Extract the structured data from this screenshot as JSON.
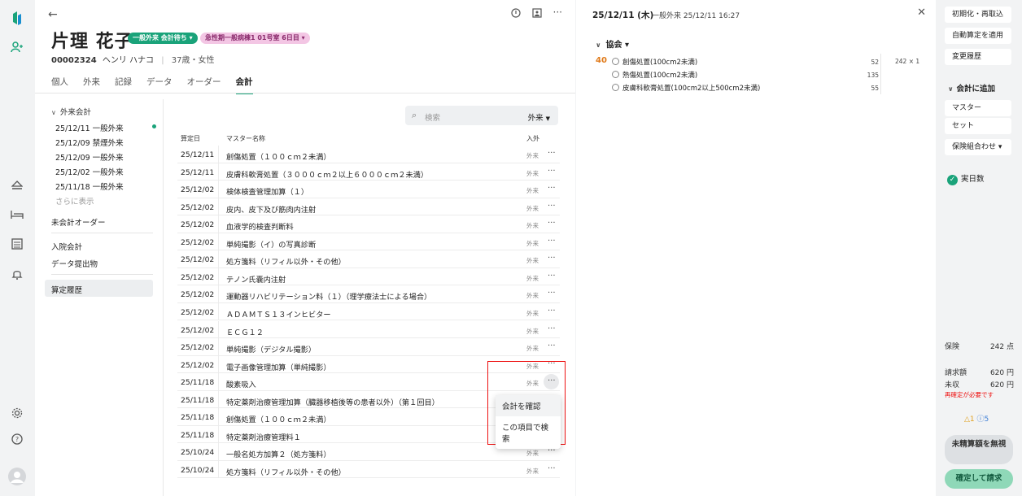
{
  "patient": {
    "name": "片理 花子",
    "status_pill": "一般外来 会計待ち ▾",
    "ward_pill": "急性期一般病棟1 01号室 6日目 ▾",
    "id": "00002324",
    "kana": "ヘンリ ハナコ",
    "age_sex": "37歳・女性",
    "tabs": [
      "個人",
      "外来",
      "記録",
      "データ",
      "オーダー",
      "会計"
    ]
  },
  "subnav": {
    "header": "外来会計",
    "visits": [
      "25/12/11 一般外来",
      "25/12/09 禁煙外来",
      "25/12/09 一般外来",
      "25/12/02 一般外来",
      "25/11/18 一般外来"
    ],
    "more": "さらに表示",
    "unbilled": "未会計オーダー",
    "inpatient": "入院会計",
    "data_export": "データ提出物",
    "history": "算定履歴"
  },
  "table": {
    "search_placeholder": "検索",
    "filter": "外来",
    "col_date": "算定日",
    "col_name": "マスター名称",
    "col_io": "入外",
    "rows": [
      {
        "date": "25/12/11",
        "name": "創傷処置（１００ｃｍ２未満）",
        "io": "外来"
      },
      {
        "date": "25/12/11",
        "name": "皮膚科軟膏処置（３０００ｃｍ２以上６０００ｃｍ２未満）",
        "io": "外来"
      },
      {
        "date": "25/12/02",
        "name": "検体検査管理加算（１）",
        "io": "外来"
      },
      {
        "date": "25/12/02",
        "name": "皮内、皮下及び筋肉内注射",
        "io": "外来"
      },
      {
        "date": "25/12/02",
        "name": "血液学的検査判断料",
        "io": "外来"
      },
      {
        "date": "25/12/02",
        "name": "単純撮影（イ）の写真診断",
        "io": "外来"
      },
      {
        "date": "25/12/02",
        "name": "処方箋料（リフィル以外・その他）",
        "io": "外来"
      },
      {
        "date": "25/12/02",
        "name": "テノン氏嚢内注射",
        "io": "外来"
      },
      {
        "date": "25/12/02",
        "name": "運動器リハビリテーション料（１）（理学療法士による場合）",
        "io": "外来"
      },
      {
        "date": "25/12/02",
        "name": "ＡＤＡＭＴＳ１３インヒビター",
        "io": "外来"
      },
      {
        "date": "25/12/02",
        "name": "ＥＣＧ１２",
        "io": "外来"
      },
      {
        "date": "25/12/02",
        "name": "単純撮影（デジタル撮影）",
        "io": "外来"
      },
      {
        "date": "25/12/02",
        "name": "電子画像管理加算（単純撮影）",
        "io": "外来"
      },
      {
        "date": "25/11/18",
        "name": "酸素吸入",
        "io": "外来"
      },
      {
        "date": "25/11/18",
        "name": "特定薬剤治療管理加算（臓器移植後等の患者以外）（第１回目）",
        "io": ""
      },
      {
        "date": "25/11/18",
        "name": "創傷処置（１００ｃｍ２未満）",
        "io": ""
      },
      {
        "date": "25/11/18",
        "name": "特定薬剤治療管理料１",
        "io": "外来"
      },
      {
        "date": "25/10/24",
        "name": "一般名処方加算２（処方箋料）",
        "io": "外来"
      },
      {
        "date": "25/10/24",
        "name": "処方箋料（リフィル以外・その他）",
        "io": "外来"
      }
    ],
    "context_menu": [
      "会計を確認",
      "この項目で検索"
    ]
  },
  "detail": {
    "date": "25/12/11 (木)",
    "subtitle": "一般外来 25/12/11 16:27",
    "insurer": "協会 ▾",
    "points": "40",
    "procedures": [
      {
        "name": "創傷処置(100cm2未満)",
        "value": "52"
      },
      {
        "name": "熱傷処置(100cm2未満)",
        "value": "135"
      },
      {
        "name": "皮膚科軟膏処置(100cm2以上500cm2未満)",
        "value": "55"
      }
    ],
    "calc": "242 × 1"
  },
  "actions": {
    "reset": "初期化・再取込",
    "auto": "自動算定を適用",
    "history": "変更履歴",
    "add_header": "会計に追加",
    "master": "マスター",
    "set": "セット",
    "insurance_combo": "保険組合わせ ▾",
    "actual_days": "実日数",
    "insurance_label": "保険",
    "insurance_points": "242 点",
    "billed_label": "請求額",
    "billed_amount": "620 円",
    "unpaid_label": "未収",
    "unpaid_amount": "620 円",
    "warning": "再確定が必要です",
    "alert_warn": "△1",
    "alert_info": "ⓘ5",
    "ignore_btn": "未精算額を無視",
    "confirm_btn": "確定して請求"
  }
}
